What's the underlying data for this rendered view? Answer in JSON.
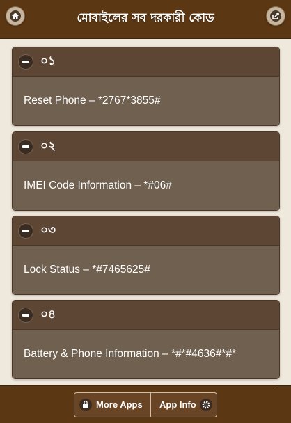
{
  "header": {
    "title": "মোবাইলের সব দরকারী কোড",
    "home_icon": "home-icon",
    "share_icon": "share-icon"
  },
  "codes": [
    {
      "number": "০১",
      "text": "Reset Phone – *2767*3855#"
    },
    {
      "number": "০২",
      "text": "IMEI Code Information – *#06#"
    },
    {
      "number": "০৩",
      "text": "Lock Status – *#7465625#"
    },
    {
      "number": "০৪",
      "text": "Battery & Phone Information – *#*#4636#*#*"
    }
  ],
  "footer": {
    "more_apps_label": "More Apps",
    "app_info_label": "App Info",
    "more_apps_icon": "shopping-bag-icon",
    "app_info_icon": "gear-icon"
  },
  "colors": {
    "header_bg": "#5b3713",
    "page_bg": "#efe8dd",
    "card_head": "#5e4634",
    "card_body": "#706050"
  }
}
